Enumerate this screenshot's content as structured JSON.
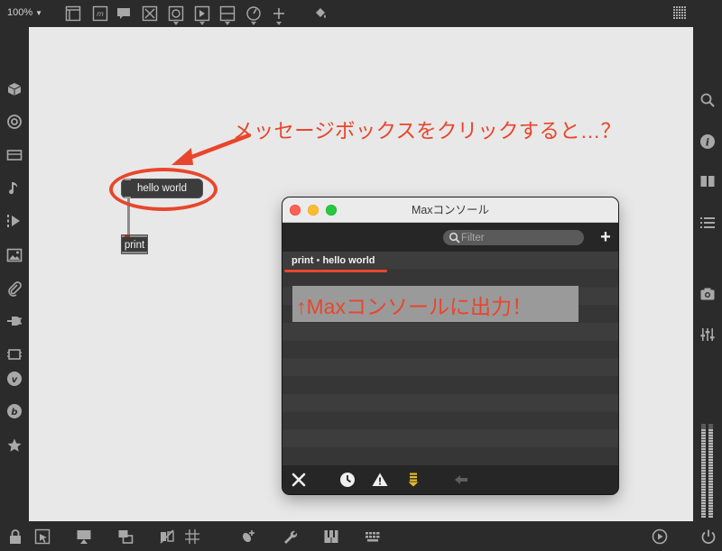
{
  "toolbar": {
    "zoom_label": "100%",
    "icons": [
      "presentation-icon",
      "comment-icon",
      "speech-icon",
      "toggle-icon",
      "bang-icon",
      "message-icon",
      "slider-icon",
      "dial-icon",
      "add-icon",
      "paint-bucket-icon",
      "grid-dots-icon"
    ]
  },
  "left_sidebar": {
    "icons": [
      "package-icon",
      "target-icon",
      "device-icon",
      "music-note-icon",
      "media-icon",
      "image-icon",
      "paperclip-icon",
      "plug-icon",
      "hardware-icon",
      "vimeo-icon",
      "bandcamp-icon",
      "star-icon"
    ]
  },
  "right_sidebar": {
    "icons": [
      "search-icon",
      "info-icon",
      "reference-icon",
      "list-icon",
      "snapshot-icon",
      "mixer-icon"
    ],
    "meter_levels": [
      0.95,
      0.95
    ]
  },
  "bottom_toolbar": {
    "icons": [
      "lock-icon",
      "edit-mode-icon",
      "presentation-icon",
      "layers-icon",
      "mute-icon",
      "grid-icon",
      "debug-icon",
      "wrench-icon",
      "keyboard-piano-icon",
      "computer-keyboard-icon",
      "audio-icon",
      "power-icon"
    ]
  },
  "patcher": {
    "message_box_text": "hello world",
    "print_object_text": "print",
    "annotation_top": "メッセージボックスをクリックすると…？"
  },
  "console": {
    "window_title": "Maxコンソール",
    "filter_placeholder": "Filter",
    "add_label": "+",
    "log_entries": [
      {
        "source": "print",
        "separator": "•",
        "message": "hello world"
      }
    ],
    "annotation_output": "↑Maxコンソールに出力！",
    "footer_icons": [
      "clear-icon",
      "timestamp-icon",
      "warning-icon",
      "scroll-down-icon",
      "back-icon"
    ]
  },
  "colors": {
    "annotation_red": "#e8462c",
    "canvas_bg": "#e8e8e8",
    "chrome_bg": "#2b2b2b"
  }
}
